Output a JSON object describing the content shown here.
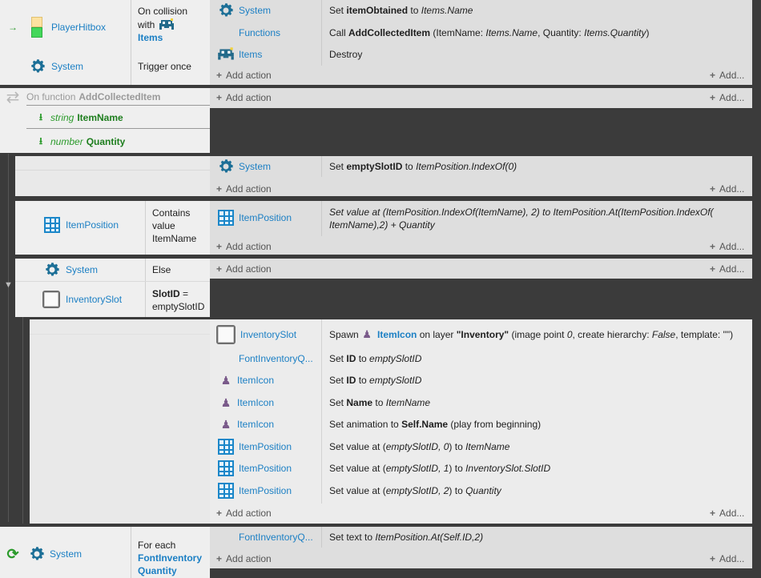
{
  "ev1": {
    "conditions": [
      {
        "object": "PlayerHitbox",
        "icon": "player-hitbox-icon",
        "text": "On collision",
        "with": "with",
        "target": "Items"
      },
      {
        "object": "System",
        "icon": "gear-icon",
        "text": "Trigger once"
      }
    ],
    "actions": [
      {
        "object": "System",
        "parts": [
          "Set ",
          "itemObtained",
          " to ",
          "Items.Name"
        ]
      },
      {
        "object": "Functions",
        "parts": [
          "Call ",
          "AddCollectedItem",
          " (ItemName: ",
          "Items.Name",
          ", Quantity: ",
          "Items.Quantity",
          ")"
        ]
      },
      {
        "object": "Items",
        "parts": [
          "Destroy"
        ]
      }
    ]
  },
  "func": {
    "prefix": "On function",
    "name": "AddCollectedItem",
    "params": [
      {
        "type": "string",
        "name": "ItemName"
      },
      {
        "type": "number",
        "name": "Quantity"
      }
    ]
  },
  "sub1": {
    "actions": [
      {
        "object": "System",
        "parts": [
          "Set ",
          "emptySlotID",
          " to ",
          "ItemPosition.IndexOf(0)"
        ]
      }
    ]
  },
  "sub2": {
    "condition": {
      "object": "ItemPosition",
      "text": "Contains\nvalue\nItemName"
    },
    "actions": [
      {
        "object": "ItemPosition",
        "line1": "Set value at (ItemPosition.IndexOf(ItemName), 2) to  ItemPosition.At(ItemPosition.IndexOf(",
        "line2": "ItemName),2) + Quantity"
      }
    ]
  },
  "sub3": {
    "conditions": [
      {
        "object": "System",
        "text": "Else"
      },
      {
        "object": "InventorySlot",
        "text_bold": "SlotID",
        "text_rest": " =",
        "text2": "emptySlotID"
      }
    ]
  },
  "sub4": {
    "actions": [
      {
        "object": "InventorySlot",
        "parts": [
          "Spawn ",
          "ItemIcon",
          " on layer ",
          "\"Inventory\"",
          " (image point ",
          "0",
          ", create hierarchy: ",
          "False",
          ", template: \"\")"
        ]
      },
      {
        "object": "FontInventoryQ...",
        "parts": [
          "Set ",
          "ID",
          " to ",
          "emptySlotID"
        ]
      },
      {
        "object": "ItemIcon",
        "parts": [
          "Set ",
          "ID",
          " to ",
          "emptySlotID"
        ]
      },
      {
        "object": "ItemIcon",
        "parts": [
          "Set ",
          "Name",
          " to ",
          "ItemName"
        ]
      },
      {
        "object": "ItemIcon",
        "parts": [
          "Set animation to ",
          "Self.Name",
          " (play from beginning)"
        ]
      },
      {
        "object": "ItemPosition",
        "parts": [
          "Set value at (",
          "emptySlotID, 0",
          ") to ",
          "ItemName"
        ]
      },
      {
        "object": "ItemPosition",
        "parts": [
          "Set value at (",
          "emptySlotID, 1",
          ") to ",
          "InventorySlot.SlotID"
        ]
      },
      {
        "object": "ItemPosition",
        "parts": [
          "Set value at (",
          "emptySlotID, 2",
          ") to ",
          "Quantity"
        ]
      }
    ]
  },
  "ev_last": {
    "condition": {
      "object": "System",
      "text": "For each",
      "target1": "FontInventory",
      "target2": "Quantity"
    },
    "actions": [
      {
        "object": "FontInventoryQ...",
        "parts": [
          "Set text to ",
          "ItemPosition.At(Self.ID,2)"
        ]
      }
    ]
  },
  "labels": {
    "add_action": "Add action",
    "add_more": "Add...",
    "plus": "+"
  },
  "colors": {
    "object_blue": "#1b7fc4",
    "param_green": "#2a9a2a",
    "sheet_bg": "#3b3b3b"
  }
}
